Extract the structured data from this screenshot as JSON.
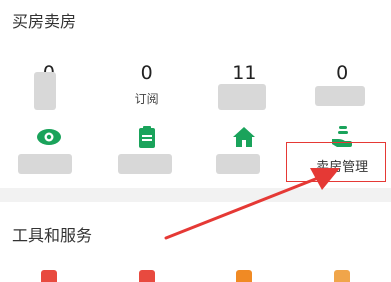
{
  "sell_section": {
    "title": "买房卖房",
    "stats": [
      {
        "value": "0",
        "label": ""
      },
      {
        "value": "0",
        "label": "订阅"
      },
      {
        "value": "11",
        "label": ""
      },
      {
        "value": "0",
        "label": ""
      }
    ],
    "actions": [
      {
        "icon": "eye-icon",
        "label": ""
      },
      {
        "icon": "clipboard-icon",
        "label": ""
      },
      {
        "icon": "house-icon",
        "label": ""
      },
      {
        "icon": "hand-coin-icon",
        "label": "卖房管理"
      }
    ]
  },
  "tools_section": {
    "title": "工具和服务",
    "icons": [
      "calculator-icon",
      "calendar-icon",
      "tag-icon",
      "hourglass-icon"
    ]
  },
  "colors": {
    "accent_green": "#1aa35b",
    "annotation_red": "#e53935",
    "background": "#f2f2f2",
    "card": "#ffffff"
  }
}
